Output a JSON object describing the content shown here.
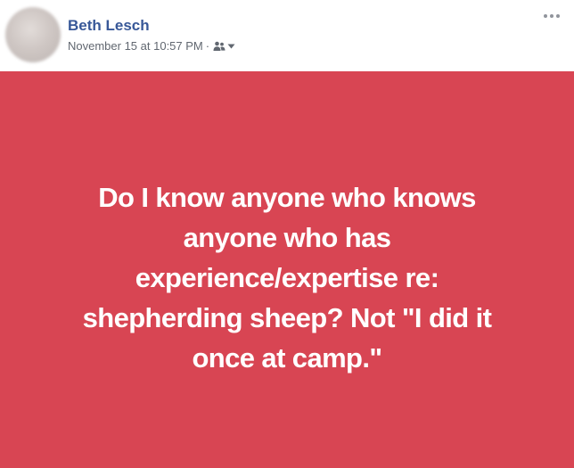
{
  "post": {
    "author": "Beth Lesch",
    "timestamp": "November 15 at 10:57 PM",
    "separator": "·",
    "audience_icon": "friends-icon",
    "more_icon": "more-options-icon",
    "background_color": "#d84553",
    "text_color": "#ffffff",
    "author_color": "#385898",
    "status_lines": [
      "Do I know anyone who knows",
      "anyone who has",
      "experience/expertise re:",
      "shepherding sheep? Not \"I did it",
      "once at camp.\""
    ]
  }
}
